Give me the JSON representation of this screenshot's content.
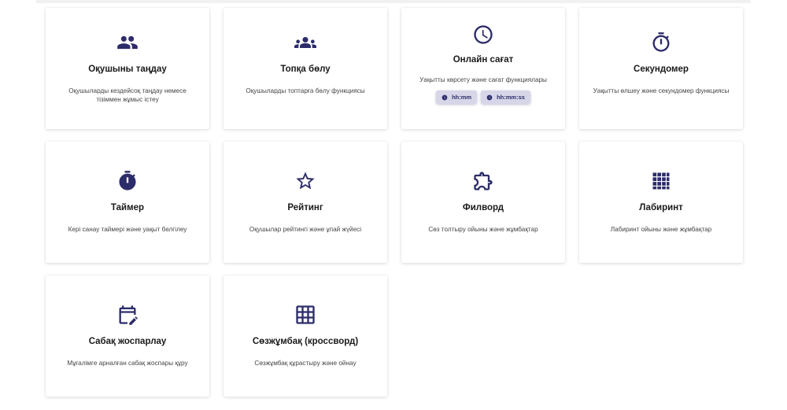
{
  "colors": {
    "accent": "#2c2c6a",
    "chip_bg": "#d6d6e8"
  },
  "cards": [
    {
      "icon": "people-icon",
      "title": "Оқушыны таңдау",
      "desc": "Оқушыларды кездейсоқ таңдау немесе тізіммен жұмыс істеу"
    },
    {
      "icon": "groups-icon",
      "title": "Топқа бөлу",
      "desc": "Оқушыларды топтарға бөлу функциясы"
    },
    {
      "icon": "clock-icon",
      "title": "Онлайн сағат",
      "desc": "Уақытты көрсету және сағат функциялары",
      "formats": [
        "hh:mm",
        "hh:mm:ss"
      ]
    },
    {
      "icon": "stopwatch-icon",
      "title": "Секундомер",
      "desc": "Уақытты өлшеу және секундомер функциясы"
    },
    {
      "icon": "timer-icon",
      "title": "Таймер",
      "desc": "Кері санау таймері және уақыт белгілеу"
    },
    {
      "icon": "star-icon",
      "title": "Рейтинг",
      "desc": "Оқушылар рейтингі және ұпай жүйесі"
    },
    {
      "icon": "puzzle-icon",
      "title": "Филворд",
      "desc": "Сөз толтыру ойыны және жұмбақтар"
    },
    {
      "icon": "grid-dense-icon",
      "title": "Лабиринт",
      "desc": "Лабиринт ойыны және жұмбақтар"
    },
    {
      "icon": "edit-calendar-icon",
      "title": "Сабақ жоспарлау",
      "desc": "Мұғалімге арналған сабақ жоспары құру"
    },
    {
      "icon": "grid-icon",
      "title": "Сөзжұмбақ (кроссворд)",
      "desc": "Сөзжұмбақ құрастыру және ойнау"
    }
  ]
}
